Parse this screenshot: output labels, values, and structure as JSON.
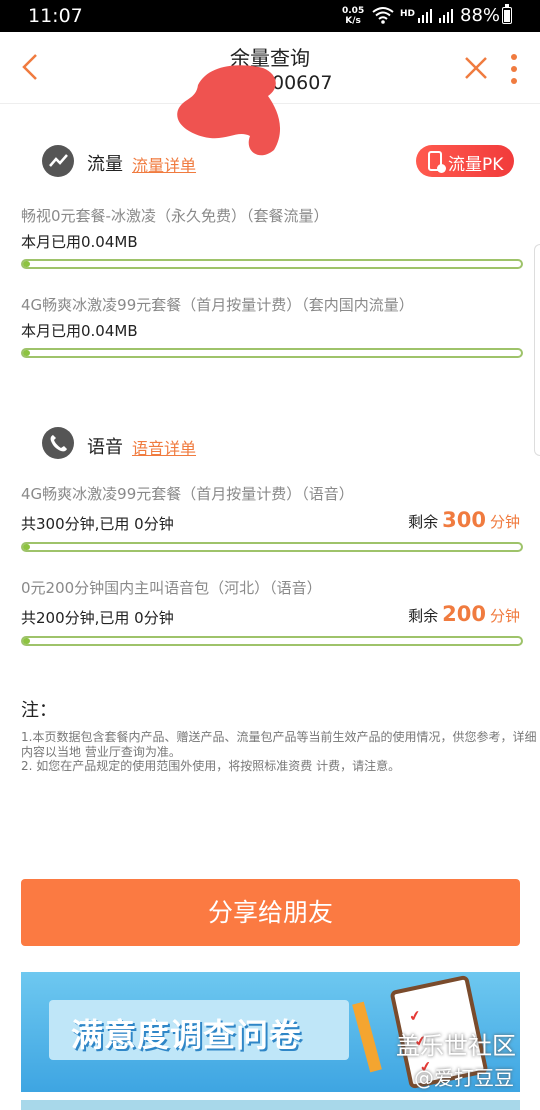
{
  "status_bar": {
    "time": "11:07",
    "net_speed": "0.05",
    "net_unit": "K/s",
    "hd": "HD",
    "battery": "88%"
  },
  "header": {
    "title": "余量查询",
    "subtitle": "00607"
  },
  "data_section": {
    "title": "流量",
    "link": "流量详单",
    "pk_label": "流量PK",
    "items": [
      {
        "name": "畅视0元套餐-冰激凌（永久免费）（套餐流量）",
        "usage": "本月已用0.04MB",
        "progress": 0.01
      },
      {
        "name": "4G畅爽冰激凌99元套餐（首月按量计费）（套内国内流量）",
        "usage": "本月已用0.04MB",
        "progress": 0.01
      }
    ]
  },
  "voice_section": {
    "title": "语音",
    "link": "语音详单",
    "items": [
      {
        "name": "4G畅爽冰激凌99元套餐（首月按量计费）（语音）",
        "usage": "共300分钟,已用 0分钟",
        "remain_label": "剩余",
        "remain_value": "300",
        "remain_unit": "分钟",
        "progress": 0.01
      },
      {
        "name": "0元200分钟国内主叫语音包（河北）（语音）",
        "usage": "共200分钟,已用 0分钟",
        "remain_label": "剩余",
        "remain_value": "200",
        "remain_unit": "分钟",
        "progress": 0.01
      }
    ]
  },
  "notes": {
    "title": "注：",
    "lines": [
      "1.本页数据包含套餐内产品、赠送产品、流量包产品等当前生效产品的使用情况，供您参考，详细内容以当地 营业厅查询为准。",
      "2. 如您在产品规定的使用范围外使用，将按照标准资费 计费，请注意。"
    ]
  },
  "share_button": "分享给朋友",
  "banner": {
    "text": "满意度调查问卷"
  },
  "watermark": {
    "line1": "盖乐世社区",
    "line2": "@爱打豆豆"
  },
  "colors": {
    "accent": "#fb7a42",
    "progress": "#8dc341",
    "pk": "#f13b3b"
  }
}
